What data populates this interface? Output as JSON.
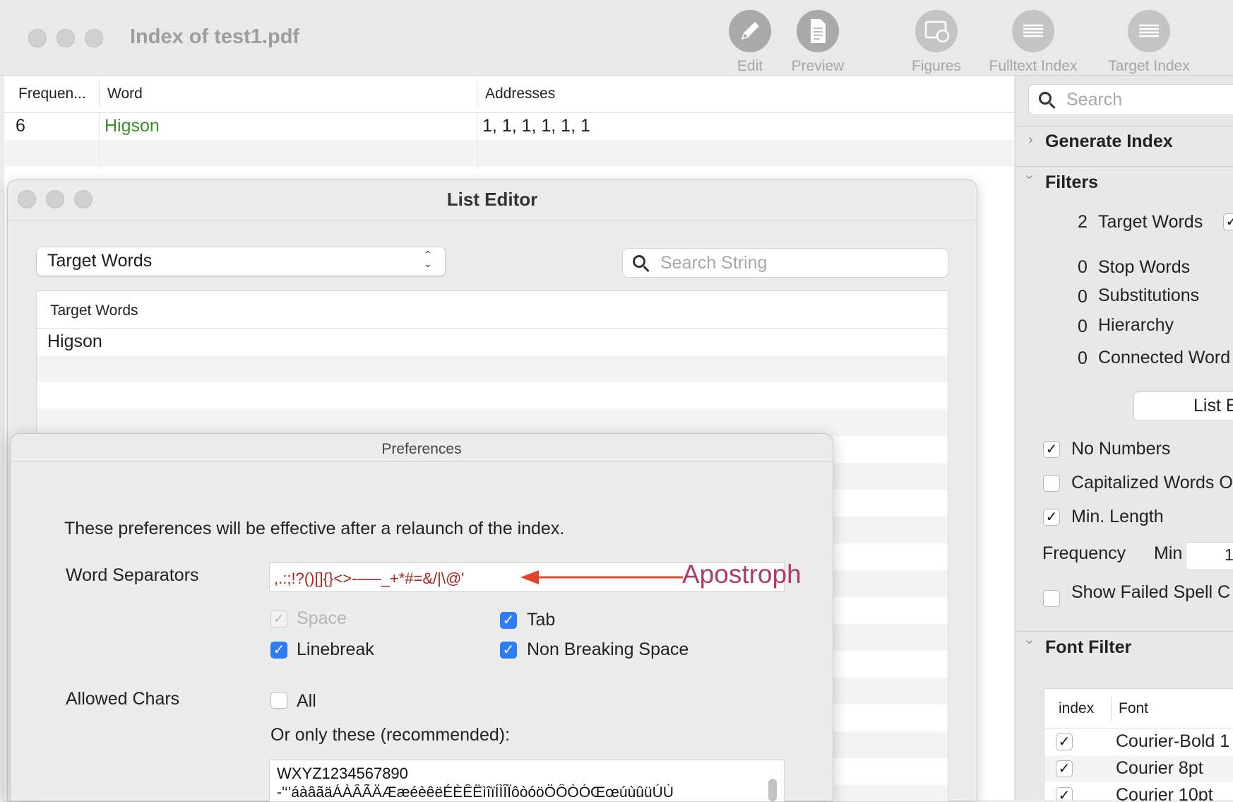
{
  "window": {
    "title": "Index of test1.pdf",
    "toolbar": [
      {
        "label": "Edit",
        "icon": "pencil-icon"
      },
      {
        "label": "Preview",
        "icon": "document-icon"
      },
      {
        "label": "Figures",
        "icon": "figures-icon"
      },
      {
        "label": "Fulltext Index",
        "icon": "list-icon"
      },
      {
        "label": "Target Index",
        "icon": "list-icon"
      }
    ]
  },
  "index_table": {
    "headers": [
      "Frequen...",
      "Word",
      "Addresses"
    ],
    "rows": [
      {
        "frequency": "6",
        "word": "Higson",
        "addresses": "1, 1, 1, 1, 1, 1"
      }
    ],
    "word_color": "#3a8f2a"
  },
  "sidebar": {
    "search_placeholder": "Search",
    "generate_index": "Generate Index",
    "filters_title": "Filters",
    "filters": [
      {
        "count": "2",
        "label": "Target Words"
      },
      {
        "count": "0",
        "label": "Stop Words"
      },
      {
        "count": "0",
        "label": "Substitutions"
      },
      {
        "count": "0",
        "label": "Hierarchy"
      },
      {
        "count": "0",
        "label": "Connected Word"
      }
    ],
    "list_button": "List E",
    "options": [
      {
        "label": "No Numbers",
        "checked": true
      },
      {
        "label": "Capitalized Words O",
        "checked": false
      },
      {
        "label": "Min. Length",
        "checked": true
      }
    ],
    "frequency_label": "Frequency",
    "min_label": "Min",
    "min_value": "1",
    "failed_spell": {
      "label": "Show Failed Spell C",
      "checked": false
    },
    "font_filter_title": "Font Filter",
    "font_table": {
      "headers": [
        "index",
        "Font"
      ],
      "rows": [
        {
          "checked": true,
          "font": "Courier-Bold 1"
        },
        {
          "checked": true,
          "font": "Courier 8pt"
        },
        {
          "checked": true,
          "font": "Courier 10pt"
        }
      ]
    }
  },
  "list_editor": {
    "title": "List Editor",
    "popup_value": "Target Words",
    "search_placeholder": "Search String",
    "table_header": "Target Words",
    "items": [
      "Higson"
    ]
  },
  "preferences": {
    "title": "Preferences",
    "notice": "These preferences will be effective after a relaunch of the index.",
    "word_separators_label": "Word Separators",
    "word_separators_value": ",.:;!?()[]{}<>-–—_+*#=&/|\\@'",
    "annotation": "Apostroph",
    "annotation_color": "#b03a6a",
    "arrow_color": "#e0442a",
    "checkboxes": [
      {
        "label": "Space",
        "checked": true,
        "disabled": true
      },
      {
        "label": "Tab",
        "checked": true,
        "disabled": false
      },
      {
        "label": "Linebreak",
        "checked": true,
        "disabled": false
      },
      {
        "label": "Non Breaking Space",
        "checked": true,
        "disabled": false
      }
    ],
    "allowed_chars_label": "Allowed Chars",
    "all_label": "All",
    "all_checked": false,
    "only_these_label": "Or only these (recommended):",
    "allowed_text_line1": "WXYZ1234567890",
    "allowed_text_line2": "-'‘’áàâãäÁÀÂÃÄÆæéèêëÉÈÊËìîïÍÌÎÏôòóöÖÔÒÓŒœúùûüÚÙ"
  }
}
